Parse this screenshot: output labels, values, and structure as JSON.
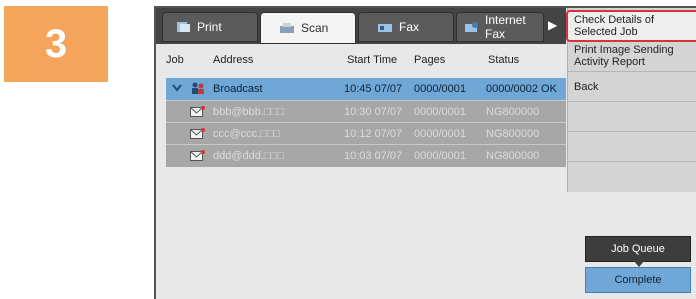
{
  "step_number": "3",
  "tabs": [
    {
      "label": "Print",
      "icon": "print-icon"
    },
    {
      "label": "Scan",
      "icon": "scan-icon"
    },
    {
      "label": "Fax",
      "icon": "fax-icon"
    },
    {
      "label": "Internet Fax",
      "icon": "internet-fax-icon"
    }
  ],
  "tab_more": "▶",
  "table": {
    "headers": {
      "job": "Job",
      "address": "Address",
      "start_time": "Start Time",
      "pages": "Pages",
      "status": "Status"
    },
    "rows": [
      {
        "address": "Broadcast",
        "start_time": "10:45 07/07",
        "pages": "0000/0001",
        "status": "0000/0002 OK"
      },
      {
        "address": "bbb@bbb.□□□",
        "start_time": "10:30 07/07",
        "pages": "0000/0001",
        "status": "NG800000"
      },
      {
        "address": "ccc@ccc.□□□",
        "start_time": "10:12 07/07",
        "pages": "0000/0001",
        "status": "NG800000"
      },
      {
        "address": "ddd@ddd.□□□",
        "start_time": "10:03 07/07",
        "pages": "0000/0001",
        "status": "NG800000"
      }
    ]
  },
  "side_menu": {
    "check_details": "Check Details of Selected Job",
    "print_report": "Print Image Sending Activity Report",
    "back": "Back"
  },
  "buttons": {
    "job_queue": "Job Queue",
    "complete": "Complete"
  },
  "colors": {
    "step_badge": "#f5a45c",
    "selected_row": "#6fa7d7",
    "highlight_border": "#d8323a"
  }
}
